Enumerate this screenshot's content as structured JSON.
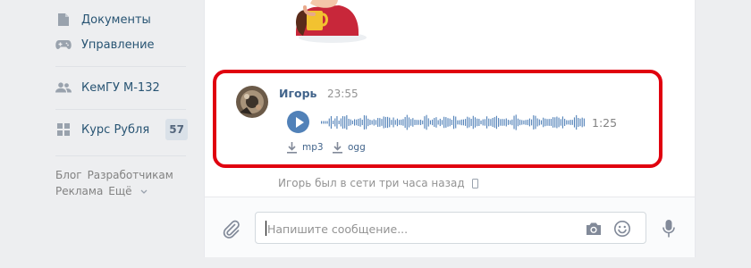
{
  "sidebar": {
    "items": [
      {
        "label": "Документы",
        "icon": "document-icon"
      },
      {
        "label": "Управление",
        "icon": "gamepad-icon"
      },
      {
        "label": "КемГУ М-132",
        "icon": "groups-icon"
      },
      {
        "label": "Курс Рубля",
        "icon": "apps-icon",
        "badge": "57"
      }
    ],
    "footer": {
      "blog": "Блог",
      "developers": "Разработчикам",
      "ads": "Реклама",
      "more": "Ещё"
    }
  },
  "message": {
    "author": "Игорь",
    "time": "23:55",
    "audio": {
      "duration": "1:25",
      "download_mp3": "mp3",
      "download_ogg": "ogg"
    }
  },
  "status": {
    "text": "Игорь был в сети три часа назад"
  },
  "composer": {
    "placeholder": "Напишите сообщение..."
  },
  "colors": {
    "link": "#285473",
    "accent": "#5181b8",
    "highlight": "#e0000f",
    "badge_bg": "#dae1e8"
  }
}
